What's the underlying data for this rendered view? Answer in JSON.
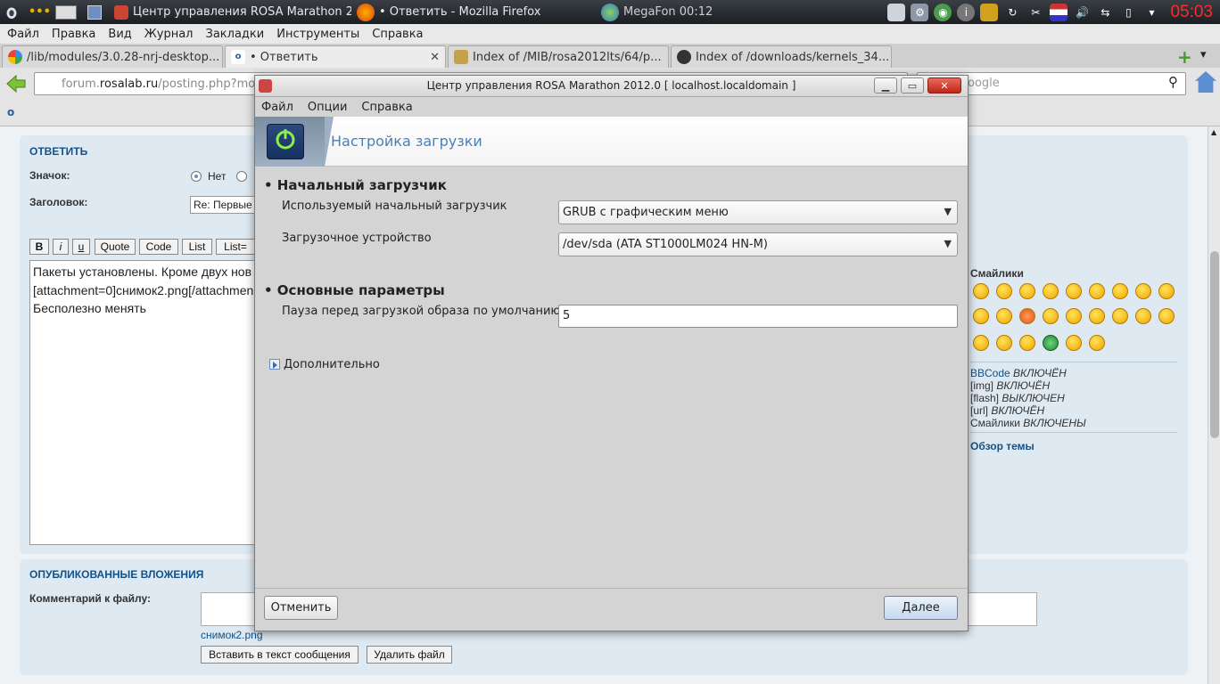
{
  "taskbar": {
    "task1": "Центр управления ROSA Marathon 20",
    "task2": "• Ответить - Mozilla Firefox",
    "network": "MegaFon 00:12",
    "clock": "05:03"
  },
  "firefox": {
    "menu": [
      "Файл",
      "Правка",
      "Вид",
      "Журнал",
      "Закладки",
      "Инструменты",
      "Справка"
    ],
    "tabs": [
      {
        "label": "/lib/modules/3.0.28-nrj-desktop..."
      },
      {
        "label": "• Ответить"
      },
      {
        "label": "Index of /MIB/rosa2012lts/64/p..."
      },
      {
        "label": "Index of /downloads/kernels_34..."
      }
    ],
    "url_prefix": "forum.",
    "url_domain": "rosalab.ru",
    "url_path": "/posting.php?mod",
    "search_placeholder": "oogle"
  },
  "page": {
    "reply_title": "ОТВЕТИТЬ",
    "icon_label": "Значок:",
    "icon_option_none": "Нет",
    "subject_label": "Заголовок:",
    "subject_value": "Re: Первые",
    "bbcodes": [
      "B",
      "i",
      "u",
      "Quote",
      "Code",
      "List",
      "List="
    ],
    "message_lines": [
      "Пакеты установлены. Кроме двух нов",
      "[attachment=0]снимок2.png[/attachmen",
      "Бесполезно менять"
    ],
    "smilies_title": "Смайлики",
    "bbcode_link": "BBCode",
    "bbcode_state": "ВКЛЮЧЁН",
    "img_tag": "[img]",
    "img_state": "ВКЛЮЧЁН",
    "flash_tag": "[flash]",
    "flash_state": "ВЫКЛЮЧЕН",
    "url_tag": "[url]",
    "url_state": "ВКЛЮЧЁН",
    "smilies_tag": "Смайлики",
    "smilies_state": "ВКЛЮЧЕНЫ",
    "topic_review": "Обзор темы",
    "attachments_title": "ОПУБЛИКОВАННЫЕ ВЛОЖЕНИЯ",
    "file_comment_label": "Комментарий к файлу:",
    "attachment_name": "снимок2.png",
    "insert_button": "Вставить в текст сообщения",
    "delete_button": "Удалить файл"
  },
  "dialog": {
    "title": "Центр управления ROSA Marathon 2012.0 [ localhost.localdomain ]",
    "menu": [
      "Файл",
      "Опции",
      "Справка"
    ],
    "banner_title": "Настройка загрузки",
    "section_bootloader": "• Начальный загрузчик",
    "bootloader_label": "Используемый начальный загрузчик",
    "bootloader_value": "GRUB с графическим меню",
    "boot_device_label": "Загрузочное устройство",
    "boot_device_value": "/dev/sda (ATA ST1000LM024 HN-M)",
    "section_main": "• Основные параметры",
    "delay_label": "Пауза перед загрузкой образа по умолчанию",
    "delay_value": "5",
    "advanced_label": "Дополнительно",
    "cancel_button": "Отменить",
    "next_button": "Далее"
  }
}
